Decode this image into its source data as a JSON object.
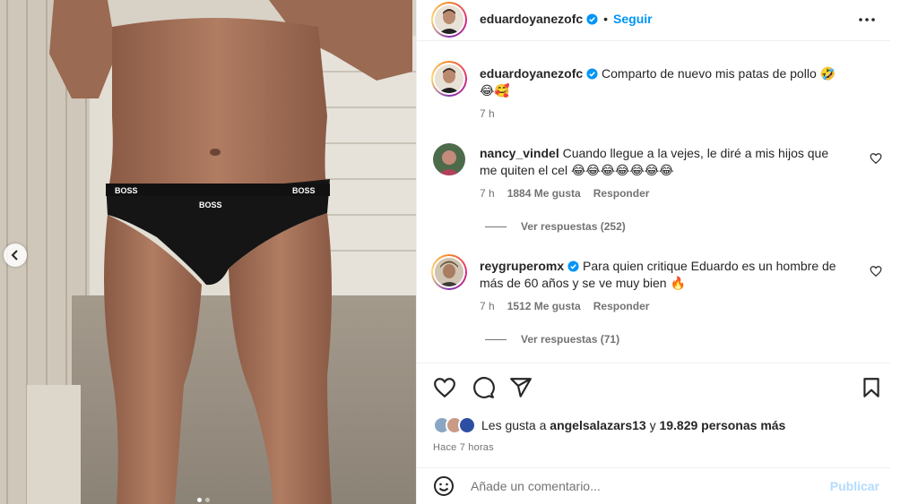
{
  "post": {
    "author": "eduardoyanezofc",
    "follow_label": "Seguir",
    "separator": "•",
    "caption_author": "eduardoyanezofc",
    "caption_text": "Comparto de nuevo mis patas de pollo 🤣",
    "caption_text_2": "😂🥰",
    "caption_time": "7 h"
  },
  "comments": [
    {
      "user": "nancy_vindel",
      "text": "Cuando llegue a la vejes, le diré a mis hijos que",
      "text_2": "me quiten el cel 😂😂😂😂😂😂😂",
      "time": "7 h",
      "likes": "1884 Me gusta",
      "reply": "Responder",
      "view_replies": "Ver respuestas (252)"
    },
    {
      "user": "reygruperomx",
      "text": "Para quien critique Eduardo es un hombre de",
      "text_2": "más de 60 años y se ve muy bien 🔥",
      "time": "7 h",
      "likes": "1512 Me gusta",
      "reply": "Responder",
      "view_replies": "Ver respuestas (71)"
    }
  ],
  "likes_summary": {
    "prefix": "Les gusta a",
    "user": "angelsalazars13",
    "middle": "y",
    "count": "19.829 personas más"
  },
  "time_ago": "Hace 7 horas",
  "comment_box": {
    "placeholder": "Añade un comentario...",
    "publish_label": "Publicar"
  },
  "icons": {
    "more": "more-horizontal-icon",
    "heart": "heart-icon",
    "comment": "comment-icon",
    "share": "send-icon",
    "save": "bookmark-icon",
    "emoji": "emoji-icon",
    "carousel_prev": "chevron-left-icon",
    "verified": "verified-badge-icon"
  },
  "colors": {
    "link": "#0095f6",
    "muted": "#737373",
    "publish_disabled": "#b3dbff"
  }
}
